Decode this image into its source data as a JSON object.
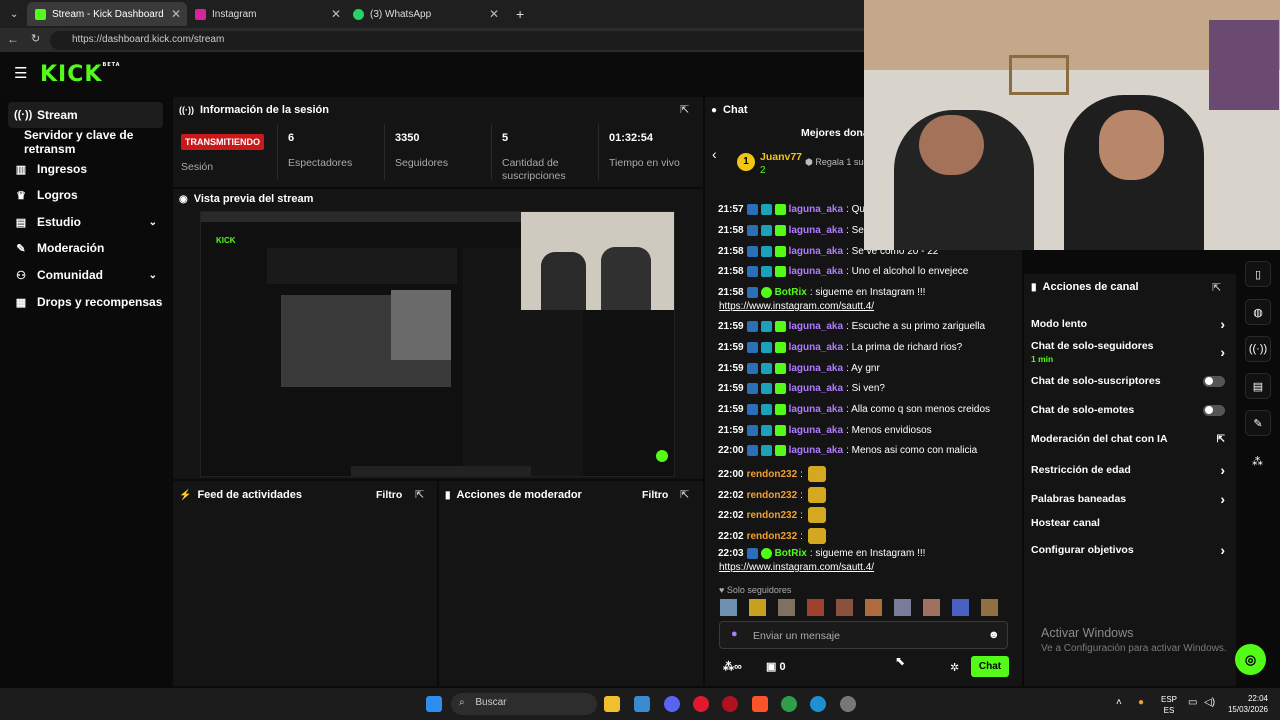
{
  "browser": {
    "tabs": [
      {
        "label": "Stream - Kick Dashboard"
      },
      {
        "label": "Instagram"
      },
      {
        "label": "(3) WhatsApp"
      }
    ],
    "url": "https://dashboard.kick.com/stream"
  },
  "brand": {
    "logo": "KICK",
    "beta": "BETA",
    "accent": "#53fc18"
  },
  "sidebar": {
    "items": [
      {
        "label": "Stream",
        "icon": "broadcast-icon"
      },
      {
        "label": "Servidor y clave de retransm"
      },
      {
        "label": "Ingresos",
        "icon": "chart-icon"
      },
      {
        "label": "Logros",
        "icon": "trophy-icon"
      },
      {
        "label": "Estudio",
        "icon": "layout-icon"
      },
      {
        "label": "Moderación",
        "icon": "wrench-icon"
      },
      {
        "label": "Comunidad",
        "icon": "users-icon"
      },
      {
        "label": "Drops y recompensas",
        "icon": "gift-icon"
      }
    ]
  },
  "session": {
    "title": "Información de la sesión",
    "status": "TRANSMITIENDO",
    "status_label": "Sesión",
    "stats": [
      {
        "value": "6",
        "label": "Espectadores"
      },
      {
        "value": "3350",
        "label": "Seguidores"
      },
      {
        "value": "5",
        "label": "Cantidad de suscripciones"
      },
      {
        "value": "01:32:54",
        "label": "Tiempo en vivo"
      }
    ]
  },
  "preview": {
    "title": "Vista previa del stream"
  },
  "feed": {
    "title": "Feed de actividades",
    "filter": "Filtro"
  },
  "mod": {
    "title": "Acciones de moderador",
    "filter": "Filtro"
  },
  "chat": {
    "title": "Chat",
    "top_label": "Mejores dona",
    "top_rank": "1",
    "top_user": "Juanv77",
    "top_amount": "2",
    "top_gift": "Regala 1 sus",
    "messages": [
      {
        "time": "21:57",
        "user": "laguna_aka",
        "text": ": Que?"
      },
      {
        "time": "21:58",
        "user": "laguna_aka",
        "text": ": Se ve r"
      },
      {
        "time": "21:58",
        "user": "laguna_aka",
        "text": ": Se ve como 20 - 22"
      },
      {
        "time": "21:58",
        "user": "laguna_aka",
        "text": ": Uno el alcohol lo envejece"
      },
      {
        "time": "21:58",
        "user": "BotRix",
        "text": ": sigueme en Instagram !!!",
        "link": "https://www.instagram.com/sautt.4/"
      },
      {
        "time": "21:59",
        "user": "laguna_aka",
        "text": ": Escuche a su primo zariguella"
      },
      {
        "time": "21:59",
        "user": "laguna_aka",
        "text": ": La prima de richard rios?"
      },
      {
        "time": "21:59",
        "user": "laguna_aka",
        "text": ": Ay gnr"
      },
      {
        "time": "21:59",
        "user": "laguna_aka",
        "text": ": Si ven?"
      },
      {
        "time": "21:59",
        "user": "laguna_aka",
        "text": ": Alla como q son menos creidos"
      },
      {
        "time": "21:59",
        "user": "laguna_aka",
        "text": ": Menos envidiosos"
      },
      {
        "time": "22:00",
        "user": "laguna_aka",
        "text": ": Menos asi como con malicia"
      },
      {
        "time": "22:00",
        "user": "rendon232",
        "text": ":"
      },
      {
        "time": "22:02",
        "user": "rendon232",
        "text": ":"
      },
      {
        "time": "22:02",
        "user": "rendon232",
        "text": ":"
      },
      {
        "time": "22:02",
        "user": "rendon232",
        "text": ":"
      },
      {
        "time": "22:03",
        "user": "BotRix",
        "text": ": sigueme en Instagram !!!",
        "link": "https://www.instagram.com/sautt.4/"
      }
    ],
    "mode": "Solo seguidores",
    "placeholder": "Enviar un mensaje",
    "infinity": "∞",
    "count": "0",
    "send": "Chat"
  },
  "channel": {
    "title": "Acciones de canal",
    "items": [
      {
        "label": "Modo lento",
        "type": "arrow"
      },
      {
        "label": "Chat de solo-seguidores",
        "sub": "1 min",
        "type": "arrow"
      },
      {
        "label": "Chat de solo-suscriptores",
        "type": "toggle"
      },
      {
        "label": "Chat de solo-emotes",
        "type": "toggle"
      },
      {
        "label": "Moderación del chat con IA",
        "type": "ext"
      },
      {
        "label": "Restricción de edad",
        "type": "arrow"
      },
      {
        "label": "Palabras baneadas",
        "type": "arrow"
      },
      {
        "label": "Hostear canal",
        "type": "none"
      },
      {
        "label": "Configurar objetivos",
        "type": "arrow"
      }
    ]
  },
  "watermark": {
    "line1": "Activar Windows",
    "line2": "Ve a Configuración para activar Windows."
  },
  "taskbar": {
    "search": "Buscar",
    "lang1": "ESP",
    "lang2": "ES",
    "time": "22:04",
    "date": "15/03/2026"
  }
}
